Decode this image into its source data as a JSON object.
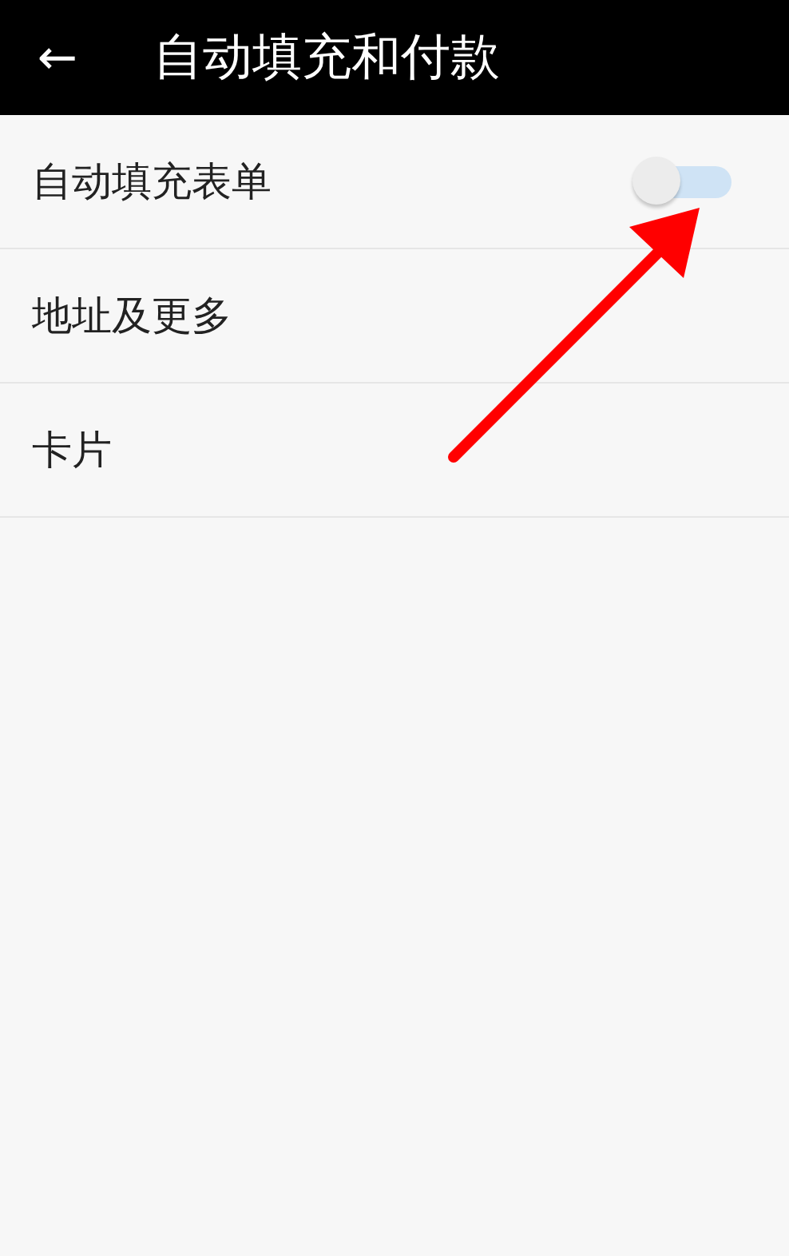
{
  "header": {
    "back_icon": "←",
    "title": "自动填充和付款"
  },
  "rows": [
    {
      "label": "自动填充表单",
      "kind": "switch",
      "on": false
    },
    {
      "label": "地址及更多",
      "kind": "link"
    },
    {
      "label": "卡片",
      "kind": "link"
    }
  ]
}
